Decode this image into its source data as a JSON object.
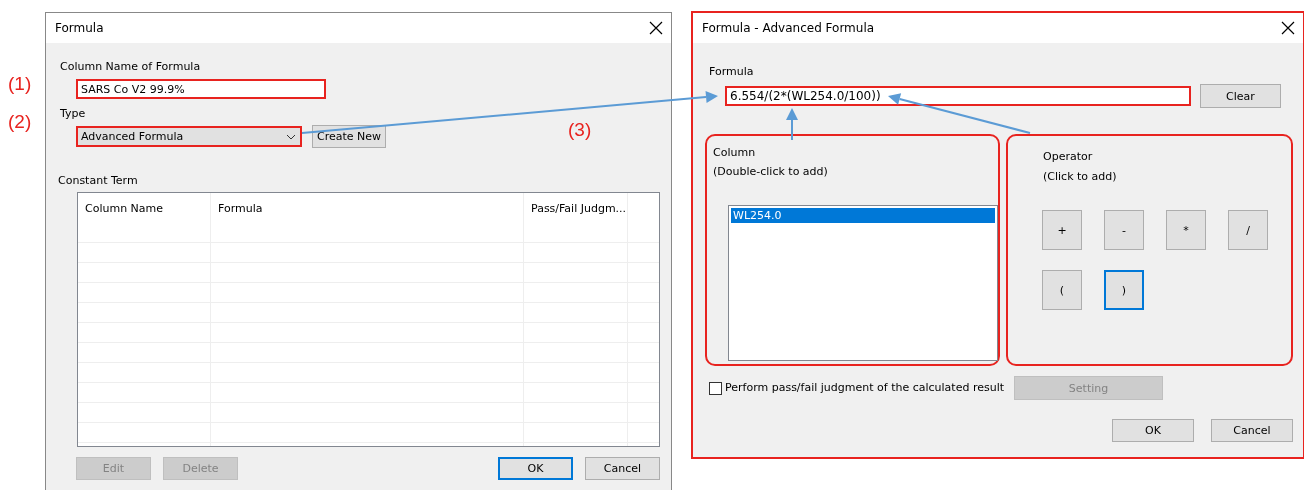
{
  "annotations": [
    "(1)",
    "(2)",
    "(3)"
  ],
  "formula_dialog": {
    "title": "Formula",
    "name_label": "Column Name of Formula",
    "name_value": "SARS Co V2 99.9%",
    "type_label": "Type",
    "type_value": "Advanced Formula",
    "create_button": "Create New",
    "constant_label": "Constant Term",
    "table": {
      "columns": [
        "Column Name",
        "Formula",
        "Pass/Fail Judgm..."
      ]
    },
    "buttons": [
      {
        "label": "Edit",
        "disabled": true,
        "focused": false
      },
      {
        "label": "Delete",
        "disabled": true,
        "focused": false
      },
      {
        "label": "OK",
        "disabled": false,
        "focused": true
      },
      {
        "label": "Cancel",
        "disabled": false,
        "focused": false
      }
    ]
  },
  "advanced_dialog": {
    "title": "Formula - Advanced Formula",
    "formula_label": "Formula",
    "formula_value": "6.554/(2*(WL254.0/100))",
    "clear_button": "Clear",
    "column_label": "Column",
    "column_hint": "(Double-click to add)",
    "columns": [
      {
        "label": "WL254.0",
        "selected": true
      }
    ],
    "operator_label": "Operator",
    "operator_hint": "(Click to add)",
    "operators": [
      {
        "label": "+",
        "focused": false
      },
      {
        "label": "-",
        "focused": false
      },
      {
        "label": "*",
        "focused": false
      },
      {
        "label": "/",
        "focused": false
      },
      {
        "label": "(",
        "focused": false
      },
      {
        "label": ")",
        "focused": true
      }
    ],
    "judgment": {
      "label": "Perform pass/fail judgment of the calculated result",
      "checked": false
    },
    "setting_button": {
      "label": "Setting",
      "disabled": true
    },
    "buttons": [
      {
        "label": "OK",
        "focused": false
      },
      {
        "label": "Cancel",
        "focused": false
      }
    ]
  }
}
